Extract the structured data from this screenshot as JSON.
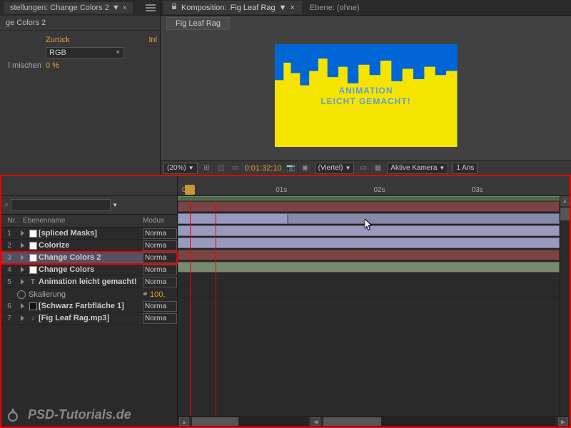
{
  "effect_panel": {
    "tab": "stellungen: Change Colors 2",
    "label": "ge Colors 2",
    "back": "Zurück",
    "inl": "Inl",
    "rgb": "RGB",
    "mix_label": "l mischen",
    "mix_value": "0 %"
  },
  "comp": {
    "tab_prefix": "Komposition:",
    "tab_name": "Fig Leaf Rag",
    "layer_tab": "Ebene: (ohne)",
    "subtab": "Fig Leaf Rag",
    "preview_line1": "ANIMATION",
    "preview_line2": "LEICHT GEMACHT!"
  },
  "viewer_footer": {
    "zoom": "(20%)",
    "timecode": "0:01:32:10",
    "res": "(Viertel)",
    "camera": "Aktive Kamera",
    "views": "1 Ans"
  },
  "timeline": {
    "search_placeholder": "",
    "header_nr": "Nr.",
    "header_name": "Ebenenname",
    "header_mode": "Modus",
    "marks": [
      "0s",
      "01s",
      "02s",
      "03s"
    ],
    "mode_normal": "Norma",
    "prop_link": "100,",
    "layers": [
      {
        "n": "1",
        "name": "[spliced Masks]",
        "color": "#fff"
      },
      {
        "n": "2",
        "name": "Colorize",
        "color": "#fff"
      },
      {
        "n": "3",
        "name": "Change Colors 2",
        "color": "#fff",
        "selected": true
      },
      {
        "n": "4",
        "name": "Change Colors",
        "color": "#fff"
      },
      {
        "n": "5",
        "name": "Animation leicht gemacht!",
        "color": "#ddd",
        "text": true
      }
    ],
    "prop_name": "Skalierung",
    "layers2": [
      {
        "n": "6",
        "name": "[Schwarz Farbfläche 1]",
        "color": "#111"
      },
      {
        "n": "7",
        "name": "[Fig Leaf Rag.mp3]",
        "color": "#3a6a6a",
        "audio": true
      }
    ]
  },
  "watermark": "PSD-Tutorials.de"
}
